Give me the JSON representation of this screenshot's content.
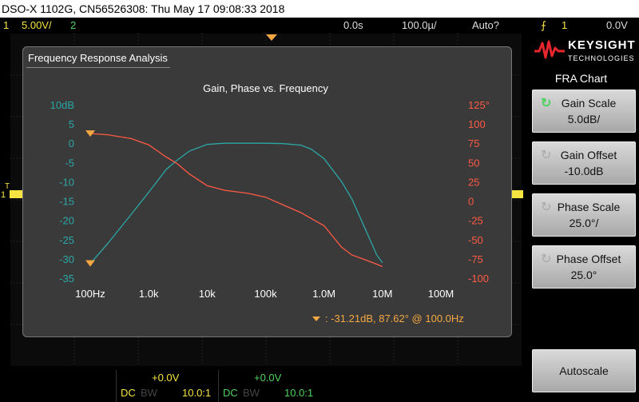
{
  "title_bar": "DSO-X 1102G, CN56526308: Thu May 17 09:08:33 2018",
  "top_bar": {
    "ch1_num": "1",
    "ch1_scale": "5.00V/",
    "ch2_num": "2",
    "time_offset": "0.0s",
    "time_scale": "100.0µ/",
    "trigger_mode": "Auto?",
    "trigger_ch": "1",
    "trigger_level": "0.0V"
  },
  "brand": {
    "name": "KEYSIGHT",
    "sub": "TECHNOLOGIES"
  },
  "menu": {
    "title": "FRA Chart",
    "buttons": [
      {
        "label": "Gain Scale",
        "value": "5.0dB/"
      },
      {
        "label": "Gain Offset",
        "value": "-10.0dB"
      },
      {
        "label": "Phase Scale",
        "value": "25.0°/"
      },
      {
        "label": "Phase Offset",
        "value": "25.0°"
      },
      {
        "label": "Autoscale",
        "value": ""
      }
    ]
  },
  "dialog": {
    "title": "Frequency Response Analysis"
  },
  "chart_data": {
    "type": "line",
    "title": "Gain, Phase vs. Frequency",
    "x_scale": "log",
    "xlim": [
      100,
      100000000
    ],
    "x_tick_labels": [
      "100Hz",
      "1.0k",
      "10k",
      "100k",
      "1.0M",
      "10M",
      "100M"
    ],
    "y_left_ticks": [
      "10dB",
      "5",
      "0",
      "-5",
      "-10",
      "-15",
      "-20",
      "-25",
      "-30",
      "-35"
    ],
    "y_left_range": [
      -35,
      10
    ],
    "y_right_ticks": [
      "125°",
      "100",
      "75",
      "50",
      "25",
      "0",
      "-25",
      "-50",
      "-75",
      "-100"
    ],
    "y_right_range": [
      -100,
      125
    ],
    "gain_color": "#2ca7a7",
    "phase_color": "#ff5a45",
    "series": [
      {
        "axis": "left",
        "x": [
          100,
          200,
          500,
          1000,
          2000,
          3000,
          5000,
          10000,
          20000,
          50000,
          100000,
          200000,
          400000,
          600000,
          1000000,
          2000000,
          3000000,
          5000000,
          8000000,
          10000000
        ],
        "values": [
          -31.2,
          -26,
          -18.5,
          -12.7,
          -6.8,
          -4.5,
          -2.0,
          -0.3,
          0,
          0,
          0,
          -0.1,
          -0.5,
          -1.5,
          -4,
          -10,
          -14.5,
          -22,
          -29,
          -31
        ]
      },
      {
        "axis": "right",
        "x": [
          100,
          200,
          500,
          1000,
          2000,
          3000,
          5000,
          10000,
          20000,
          50000,
          100000,
          200000,
          400000,
          1000000,
          2000000,
          3000000,
          5000000,
          8000000,
          10000000
        ],
        "values": [
          87.6,
          86,
          81,
          73,
          57,
          49,
          35,
          20,
          14,
          10,
          5,
          -5,
          -15,
          -32,
          -60,
          -70,
          -76,
          -82,
          -85
        ]
      }
    ],
    "marker_readout": ":  -31.21dB, 87.62° @ 100.0Hz"
  },
  "channels_bottom": [
    {
      "offset": "+0.0V",
      "coupling": "DC",
      "bw": "BW",
      "probe": "10.0:1"
    },
    {
      "offset": "+0.0V",
      "coupling": "DC",
      "bw": "BW",
      "probe": "10.0:1"
    }
  ],
  "left_marker": {
    "t": "T",
    "ch": "1"
  }
}
